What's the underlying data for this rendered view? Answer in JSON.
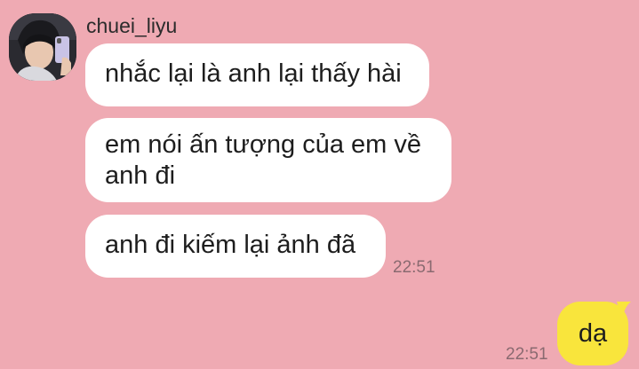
{
  "contact": {
    "name": "chuei_liyu"
  },
  "messages": [
    {
      "from": "contact",
      "text": "nhắc lại là anh lại thấy hài"
    },
    {
      "from": "contact",
      "text": "em nói ấn tượng của em về anh đi"
    },
    {
      "from": "contact",
      "text": "anh đi kiếm lại ảnh đã",
      "time": "22:51"
    },
    {
      "from": "me",
      "text": "dạ",
      "time": "22:51"
    }
  ],
  "colors": {
    "background": "#efaab3",
    "incoming_bubble": "#ffffff",
    "outgoing_bubble": "#f9e53c",
    "timestamp": "#8a6a70"
  }
}
